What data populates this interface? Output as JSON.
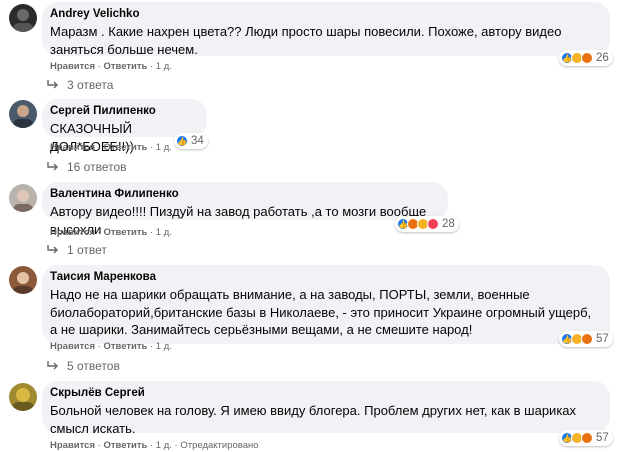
{
  "labels": {
    "like": "Нравится",
    "reply": "Ответить",
    "sep": "·"
  },
  "comments": [
    {
      "author": "Andrey Velichko",
      "text": "Маразм . Какие нахрен цвета?? Люди просто шары повесили. Похоже, автору видео заняться больше нечем.",
      "time": "1 д.",
      "reaction_count": "26",
      "replies": "3 ответа"
    },
    {
      "author": "Сергей Пилипенко",
      "text": "СКАЗОЧНЫЙ ДОЛ*БОЕБ!!))",
      "time": "1 д.",
      "reaction_count": "34",
      "replies": "16 ответов"
    },
    {
      "author": "Валентина Филипенко",
      "text": "Автору видео!!!! Пиздуй на завод работать ,а то мозги вообще высохли",
      "time": "1 д.",
      "reaction_count": "28",
      "replies": "1 ответ"
    },
    {
      "author": "Таисия Маренкова",
      "text": "Надо не на шарики обращать внимание, а на заводы, ПОРТЫ, земли, военные биолабораторий,британские базы в Николаеве, - это приносит Украине огромный ущерб, а не шарики. Занимайтесь серьёзными вещами, а не смешите народ!",
      "time": "1 д.",
      "reaction_count": "57",
      "replies": "5 ответов"
    },
    {
      "author": "Скрылёв Сергей",
      "text": "Больной человек на голову. Я имею ввиду блогера. Проблем других нет, как в шариках смысл искать.",
      "time": "1 д.",
      "edited": "Отредактировано",
      "reaction_count": "57"
    }
  ]
}
